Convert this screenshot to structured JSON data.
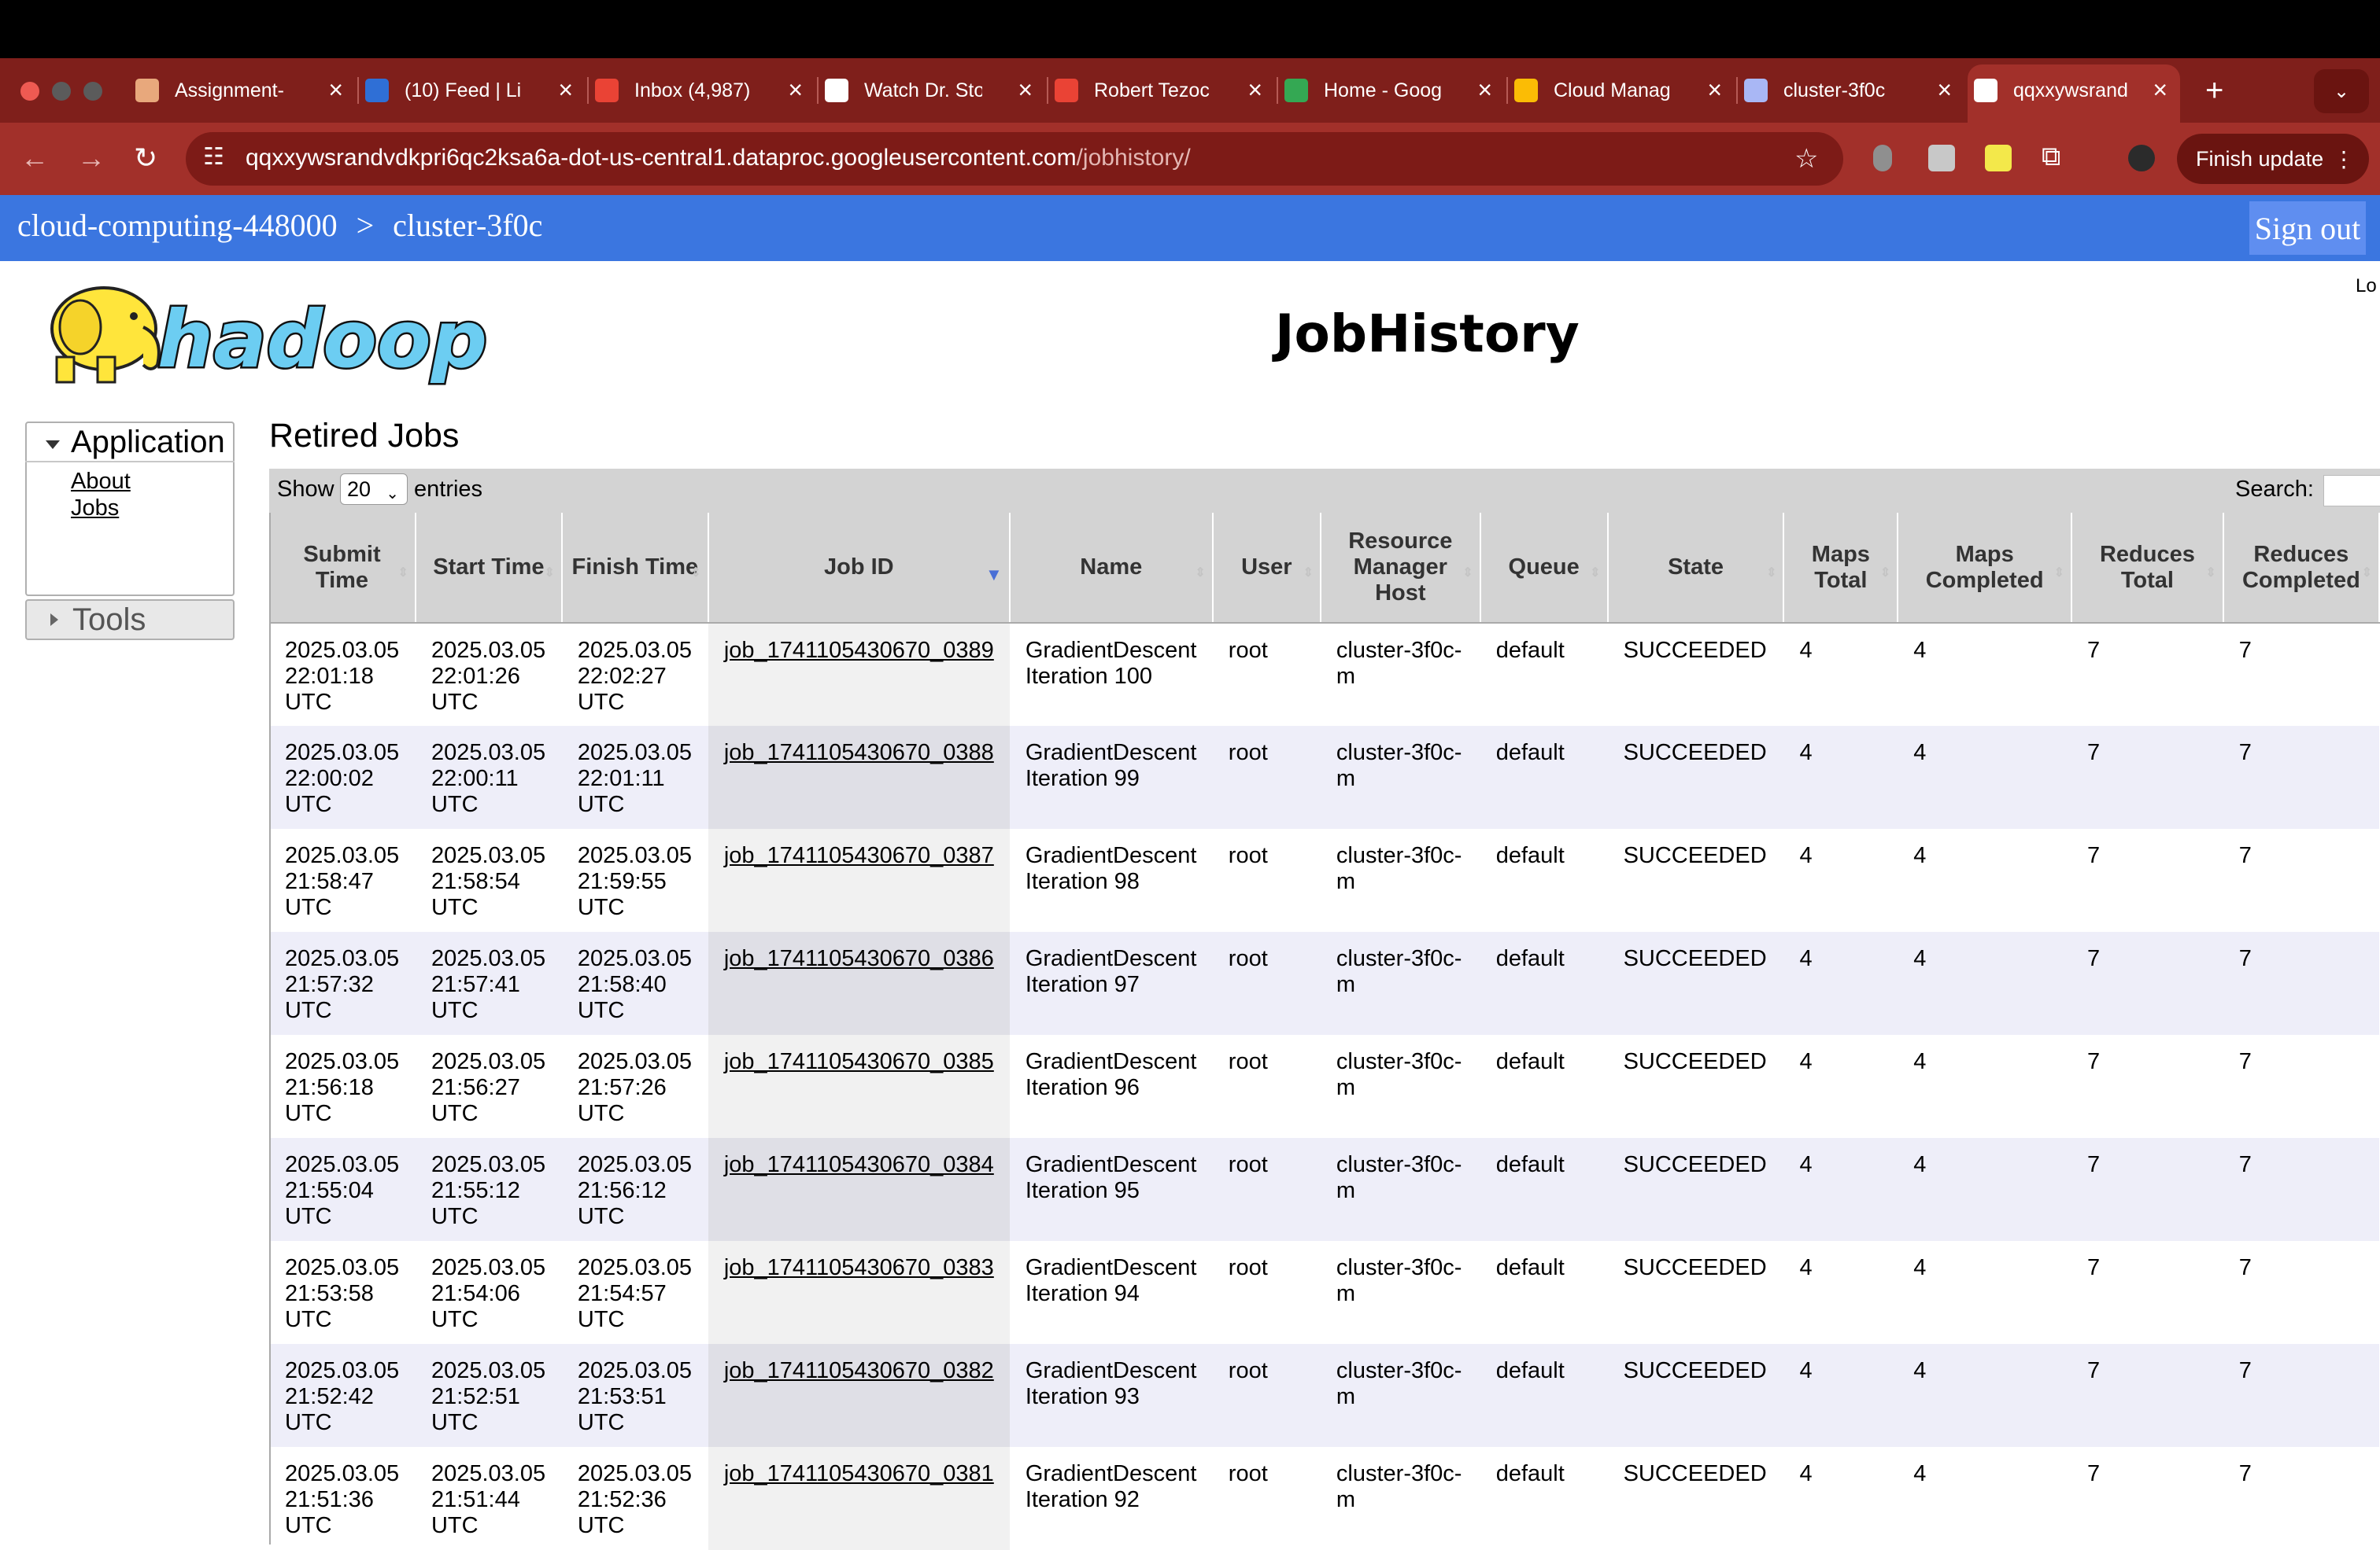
{
  "browser": {
    "tabs": [
      {
        "title": "Assignment-",
        "icon": "assignment-icon",
        "color": "#e8a87c"
      },
      {
        "title": "(10) Feed | Li",
        "icon": "linkedin-icon",
        "color": "#2f6fd6"
      },
      {
        "title": "Inbox (4,987)",
        "icon": "gmail-icon",
        "color": "#ea4335"
      },
      {
        "title": "Watch Dr. Sto",
        "icon": "watch-icon",
        "color": "#ffffff"
      },
      {
        "title": "Robert Tezoc",
        "icon": "gmail-icon",
        "color": "#ea4335"
      },
      {
        "title": "Home - Goog",
        "icon": "drive-icon",
        "color": "#34a853"
      },
      {
        "title": "Cloud Manag",
        "icon": "cloud-icon",
        "color": "#fbbc05"
      },
      {
        "title": "cluster-3f0c",
        "icon": "dataproc-icon",
        "color": "#a9b7f5"
      },
      {
        "title": "qqxxywsrand",
        "icon": "google-icon",
        "color": "#ffffff"
      }
    ],
    "new_tab_label": "+",
    "url_host": "qqxxywsrandvdkpri6qc2ksa6a-dot-us-central1.dataproc.googleusercontent.com",
    "url_path": "/jobhistory/",
    "finish_update_label": "Finish update"
  },
  "header": {
    "project": "cloud-computing-448000",
    "separator": ">",
    "cluster": "cluster-3f0c",
    "sign_out_label": "Sign out"
  },
  "page": {
    "logo_text": "hadoop",
    "title": "JobHistory",
    "logged_in_partial": "Lo"
  },
  "sidebar": {
    "application_label": "Application",
    "links": [
      "About",
      "Jobs"
    ],
    "tools_label": "Tools"
  },
  "table": {
    "section_title": "Retired Jobs",
    "show_label": "Show",
    "page_length": "20",
    "entries_label": "entries",
    "search_label": "Search:",
    "columns": [
      "Submit Time",
      "Start Time",
      "Finish Time",
      "Job ID",
      "Name",
      "User",
      "Resource Manager Host",
      "Queue",
      "State",
      "Maps Total",
      "Maps Completed",
      "Reduces Total",
      "Reduces Completed"
    ],
    "rows": [
      {
        "submit": "2025.03.05 22:01:18 UTC",
        "start": "2025.03.05 22:01:26 UTC",
        "finish": "2025.03.05 22:02:27 UTC",
        "job_id": "job_1741105430670_0389",
        "name": "GradientDescent Iteration 100",
        "user": "root",
        "rm_host": "cluster-3f0c-m",
        "queue": "default",
        "state": "SUCCEEDED",
        "maps_total": "4",
        "maps_completed": "4",
        "reduces_total": "7",
        "reduces_completed": "7"
      },
      {
        "submit": "2025.03.05 22:00:02 UTC",
        "start": "2025.03.05 22:00:11 UTC",
        "finish": "2025.03.05 22:01:11 UTC",
        "job_id": "job_1741105430670_0388",
        "name": "GradientDescent Iteration 99",
        "user": "root",
        "rm_host": "cluster-3f0c-m",
        "queue": "default",
        "state": "SUCCEEDED",
        "maps_total": "4",
        "maps_completed": "4",
        "reduces_total": "7",
        "reduces_completed": "7"
      },
      {
        "submit": "2025.03.05 21:58:47 UTC",
        "start": "2025.03.05 21:58:54 UTC",
        "finish": "2025.03.05 21:59:55 UTC",
        "job_id": "job_1741105430670_0387",
        "name": "GradientDescent Iteration 98",
        "user": "root",
        "rm_host": "cluster-3f0c-m",
        "queue": "default",
        "state": "SUCCEEDED",
        "maps_total": "4",
        "maps_completed": "4",
        "reduces_total": "7",
        "reduces_completed": "7"
      },
      {
        "submit": "2025.03.05 21:57:32 UTC",
        "start": "2025.03.05 21:57:41 UTC",
        "finish": "2025.03.05 21:58:40 UTC",
        "job_id": "job_1741105430670_0386",
        "name": "GradientDescent Iteration 97",
        "user": "root",
        "rm_host": "cluster-3f0c-m",
        "queue": "default",
        "state": "SUCCEEDED",
        "maps_total": "4",
        "maps_completed": "4",
        "reduces_total": "7",
        "reduces_completed": "7"
      },
      {
        "submit": "2025.03.05 21:56:18 UTC",
        "start": "2025.03.05 21:56:27 UTC",
        "finish": "2025.03.05 21:57:26 UTC",
        "job_id": "job_1741105430670_0385",
        "name": "GradientDescent Iteration 96",
        "user": "root",
        "rm_host": "cluster-3f0c-m",
        "queue": "default",
        "state": "SUCCEEDED",
        "maps_total": "4",
        "maps_completed": "4",
        "reduces_total": "7",
        "reduces_completed": "7"
      },
      {
        "submit": "2025.03.05 21:55:04 UTC",
        "start": "2025.03.05 21:55:12 UTC",
        "finish": "2025.03.05 21:56:12 UTC",
        "job_id": "job_1741105430670_0384",
        "name": "GradientDescent Iteration 95",
        "user": "root",
        "rm_host": "cluster-3f0c-m",
        "queue": "default",
        "state": "SUCCEEDED",
        "maps_total": "4",
        "maps_completed": "4",
        "reduces_total": "7",
        "reduces_completed": "7"
      },
      {
        "submit": "2025.03.05 21:53:58 UTC",
        "start": "2025.03.05 21:54:06 UTC",
        "finish": "2025.03.05 21:54:57 UTC",
        "job_id": "job_1741105430670_0383",
        "name": "GradientDescent Iteration 94",
        "user": "root",
        "rm_host": "cluster-3f0c-m",
        "queue": "default",
        "state": "SUCCEEDED",
        "maps_total": "4",
        "maps_completed": "4",
        "reduces_total": "7",
        "reduces_completed": "7"
      },
      {
        "submit": "2025.03.05 21:52:42 UTC",
        "start": "2025.03.05 21:52:51 UTC",
        "finish": "2025.03.05 21:53:51 UTC",
        "job_id": "job_1741105430670_0382",
        "name": "GradientDescent Iteration 93",
        "user": "root",
        "rm_host": "cluster-3f0c-m",
        "queue": "default",
        "state": "SUCCEEDED",
        "maps_total": "4",
        "maps_completed": "4",
        "reduces_total": "7",
        "reduces_completed": "7"
      },
      {
        "submit": "2025.03.05 21:51:36 UTC",
        "start": "2025.03.05 21:51:44 UTC",
        "finish": "2025.03.05 21:52:36 UTC",
        "job_id": "job_1741105430670_0381",
        "name": "GradientDescent Iteration 92",
        "user": "root",
        "rm_host": "cluster-3f0c-m",
        "queue": "default",
        "state": "SUCCEEDED",
        "maps_total": "4",
        "maps_completed": "4",
        "reduces_total": "7",
        "reduces_completed": "7"
      }
    ]
  }
}
